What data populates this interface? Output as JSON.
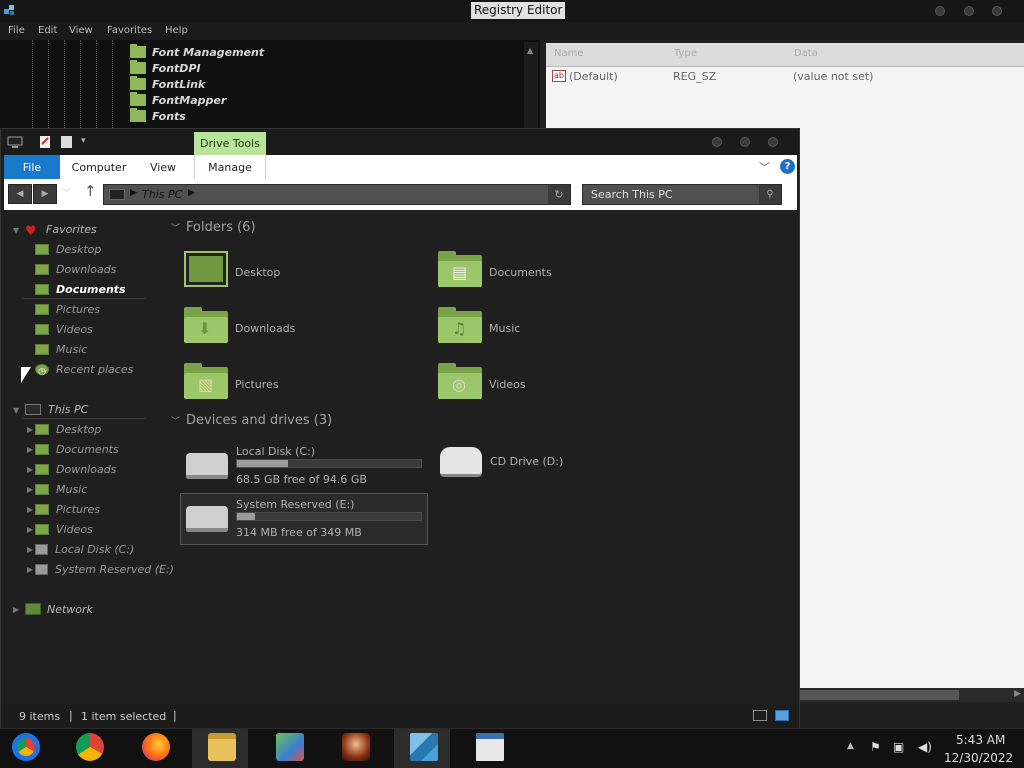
{
  "registry": {
    "title": "Registry Editor",
    "menu": [
      "File",
      "Edit",
      "View",
      "Favorites",
      "Help"
    ],
    "keys": [
      "Font Management",
      "FontDPI",
      "FontLink",
      "FontMapper",
      "Fonts"
    ],
    "value_row": {
      "name": "(Default)",
      "type": "REG_SZ",
      "data": "(value not set)"
    },
    "columns": [
      "Name",
      "Type",
      "Data"
    ]
  },
  "explorer": {
    "context_tab": "Drive Tools",
    "ribbon_tabs": [
      "File",
      "Computer",
      "View",
      "Manage"
    ],
    "address": "This PC",
    "search_placeholder": "Search This PC",
    "nav": {
      "favorites": "Favorites",
      "favorites_items": [
        "Desktop",
        "Downloads",
        "Documents",
        "Pictures",
        "Videos",
        "Music",
        "Recent places"
      ],
      "this_pc": "This PC",
      "this_pc_items": [
        "Desktop",
        "Documents",
        "Downloads",
        "Music",
        "Pictures",
        "Videos",
        "Local Disk (C:)",
        "System Reserved (E:)"
      ],
      "network": "Network"
    },
    "folders_header": "Folders (6)",
    "folders": [
      "Desktop",
      "Documents",
      "Downloads",
      "Music",
      "Pictures",
      "Videos"
    ],
    "drives_header": "Devices and drives (3)",
    "drives": [
      {
        "name": "Local Disk (C:)",
        "free": "68.5 GB free of 94.6 GB",
        "used_fraction": 0.276
      },
      {
        "name": "CD Drive (D:)"
      },
      {
        "name": "System Reserved (E:)",
        "free": "314 MB free of 349 MB",
        "used_fraction": 0.1
      }
    ],
    "status": {
      "items": "9 items",
      "selected": "1 item selected",
      "sep": "|"
    }
  },
  "taskbar": {
    "apps": [
      "chrome-beta",
      "chrome",
      "firefox",
      "file-explorer",
      "user-accounts",
      "game",
      "registry-editor",
      "window-app"
    ],
    "time": "5:43 AM",
    "date": "12/30/2022"
  },
  "colors": {
    "accent_green": "#9bc66a",
    "ribbon_file": "#1979ca",
    "drive_tools": "#b8e39b"
  }
}
